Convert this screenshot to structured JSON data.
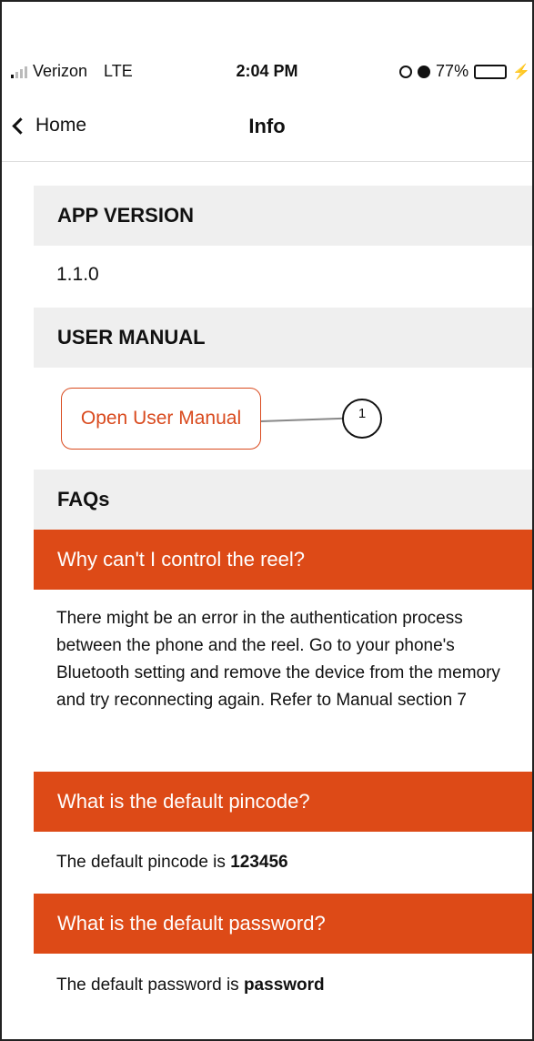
{
  "status_bar": {
    "carrier": "Verizon",
    "network": "LTE",
    "time": "2:04 PM",
    "battery": "77%",
    "battery_level": 0.77
  },
  "nav": {
    "back_label": "Home",
    "title": "Info"
  },
  "sections": {
    "app_version": {
      "header": "APP VERSION",
      "value": "1.1.0"
    },
    "user_manual": {
      "header": "USER MANUAL",
      "button_label": "Open User Manual",
      "callout": "1"
    },
    "faqs": {
      "header": "FAQs"
    }
  },
  "faqs": [
    {
      "question": "Why can't I control the reel?",
      "answer": "There might be an error in the authentication process between the phone and the reel. Go to your phone's Bluetooth setting and remove the device from the memory and try reconnecting again. Refer to Manual section 7"
    },
    {
      "question": "What is the default pincode?",
      "answer_prefix": "The default pincode is ",
      "answer_value": "123456"
    },
    {
      "question": "What is the default password?",
      "answer_prefix": "The default password is ",
      "answer_value": "password"
    }
  ],
  "colors": {
    "accent": "#dd4a17",
    "section_bg": "#efefef",
    "battery": "#34c759"
  }
}
